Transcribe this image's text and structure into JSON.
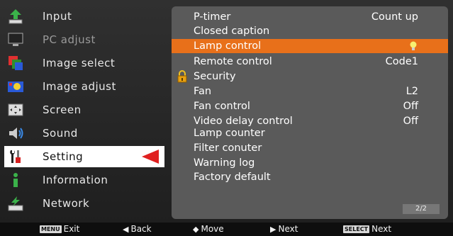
{
  "left_menu": {
    "items": [
      {
        "label": "Input",
        "icon": "input-icon"
      },
      {
        "label": "PC adjust",
        "icon": "pc-adjust-icon"
      },
      {
        "label": "Image select",
        "icon": "image-select-icon"
      },
      {
        "label": "Image adjust",
        "icon": "image-adjust-icon"
      },
      {
        "label": "Screen",
        "icon": "screen-icon"
      },
      {
        "label": "Sound",
        "icon": "sound-icon"
      },
      {
        "label": "Setting",
        "icon": "setting-icon"
      },
      {
        "label": "Information",
        "icon": "information-icon"
      },
      {
        "label": "Network",
        "icon": "network-icon"
      }
    ],
    "selected": "Setting",
    "disabled": [
      "PC adjust"
    ]
  },
  "settings_panel": {
    "rows": [
      {
        "label": "P-timer",
        "value": "Count up"
      },
      {
        "label": "Closed caption",
        "value": ""
      },
      {
        "label": "Lamp control",
        "value": ""
      },
      {
        "label": "Remote control",
        "value": "Code1"
      },
      {
        "label": "Security",
        "value": ""
      },
      {
        "label": "Fan",
        "value": "L2"
      },
      {
        "label": "Fan control",
        "value": "Off"
      },
      {
        "label": "Video delay control",
        "value": "Off"
      },
      {
        "label": "Lamp counter",
        "value": ""
      },
      {
        "label": "Filter conuter",
        "value": ""
      },
      {
        "label": "Warning log",
        "value": ""
      },
      {
        "label": "Factory default",
        "value": ""
      }
    ],
    "highlighted": "Lamp control",
    "page_indicator": "2/2"
  },
  "bottom_bar": {
    "exit": {
      "key": "MENU",
      "label": "Exit"
    },
    "back": {
      "glyph": "◀",
      "label": "Back"
    },
    "move": {
      "glyph": "◆",
      "label": "Move"
    },
    "next_arrow": {
      "glyph": "▶",
      "label": "Next"
    },
    "next_select": {
      "key": "SELECT",
      "label": "Next"
    }
  },
  "colors": {
    "highlight": "#e8701a",
    "selected_arrow": "#e02020",
    "panel": "#5a5a5a"
  }
}
